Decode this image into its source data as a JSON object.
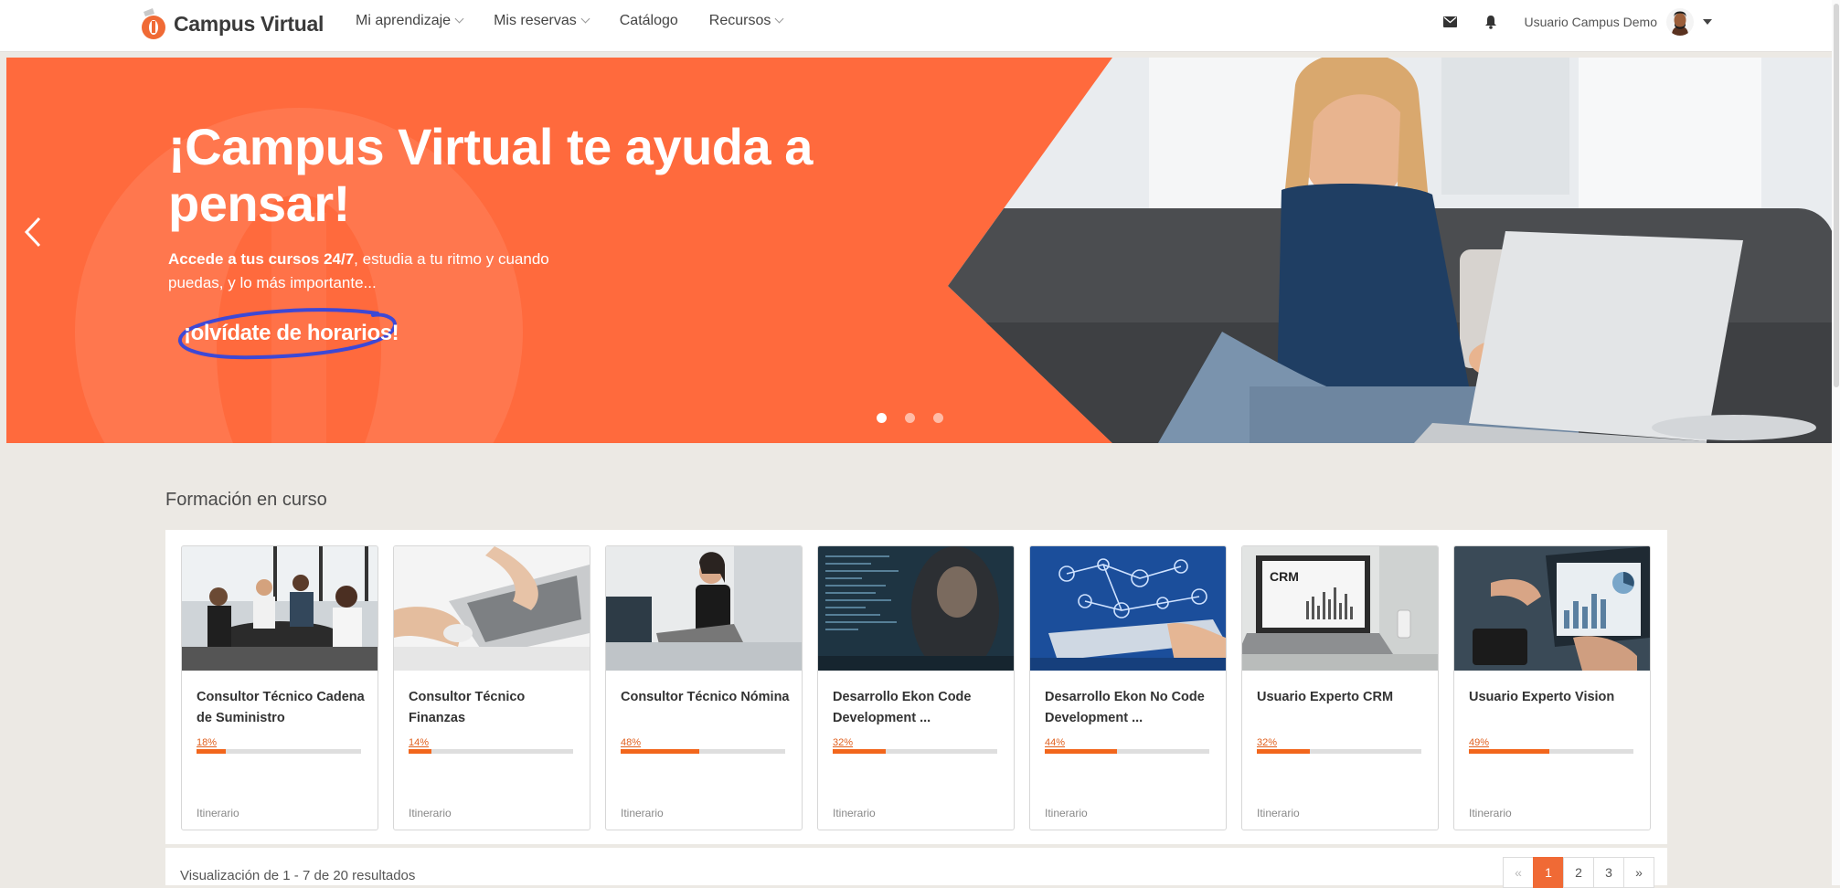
{
  "brand": {
    "name": "Campus Virtual",
    "accent": "#f06a35"
  },
  "nav": {
    "items": [
      {
        "label": "Mi aprendizaje",
        "dropdown": true
      },
      {
        "label": "Mis reservas",
        "dropdown": true
      },
      {
        "label": "Catálogo",
        "dropdown": false
      },
      {
        "label": "Recursos",
        "dropdown": true
      }
    ],
    "user_name": "Usuario Campus Demo",
    "icons": [
      "mail-icon",
      "bell-icon",
      "avatar",
      "caret-down-icon"
    ]
  },
  "hero": {
    "title": "¡Campus Virtual te ayuda a pensar!",
    "subtitle_bold": "Accede a tus cursos 24/7",
    "subtitle_rest": ", estudia a tu ritmo y cuando puedas, y lo más importante...",
    "cta": "¡olvídate de horarios!",
    "slides": 3,
    "active_slide": 1,
    "background": "#ff6a3d"
  },
  "section": {
    "title": "Formación en curso"
  },
  "courses": [
    {
      "title": "Consultor Técnico Cadena de Suministro",
      "progress": 18,
      "progress_label": "18%",
      "type": "Itinerario"
    },
    {
      "title": "Consultor Técnico Finanzas",
      "progress": 14,
      "progress_label": "14%",
      "type": "Itinerario"
    },
    {
      "title": "Consultor Técnico Nómina",
      "progress": 48,
      "progress_label": "48%",
      "type": "Itinerario"
    },
    {
      "title": "Desarrollo Ekon Code Development ...",
      "progress": 32,
      "progress_label": "32%",
      "type": "Itinerario"
    },
    {
      "title": "Desarrollo Ekon No Code Development ...",
      "progress": 44,
      "progress_label": "44%",
      "type": "Itinerario"
    },
    {
      "title": "Usuario Experto CRM",
      "progress": 32,
      "progress_label": "32%",
      "type": "Itinerario"
    },
    {
      "title": "Usuario Experto Vision",
      "progress": 49,
      "progress_label": "49%",
      "type": "Itinerario"
    }
  ],
  "results": {
    "text": "Visualización de 1 - 7 de 20 resultados"
  },
  "pagination": {
    "prev": "«",
    "pages": [
      "1",
      "2",
      "3"
    ],
    "active": "1",
    "next": "»"
  }
}
